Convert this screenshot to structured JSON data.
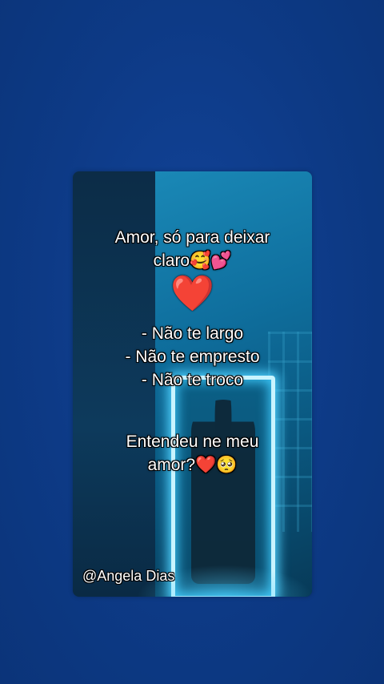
{
  "post": {
    "line1": "Amor, só para deixar",
    "line2": "claro🥰💕",
    "heart": "❤️",
    "list": [
      "- Não te largo",
      "- Não te empresto",
      "- Não te troco"
    ],
    "question_line1": "Entendeu ne meu",
    "question_line2": "amor?❤️🥺",
    "watermark": "@Angela Dias"
  },
  "colors": {
    "background": "#0d3a86",
    "heart": "#e51b2a",
    "neon": "#4fd2ff"
  }
}
